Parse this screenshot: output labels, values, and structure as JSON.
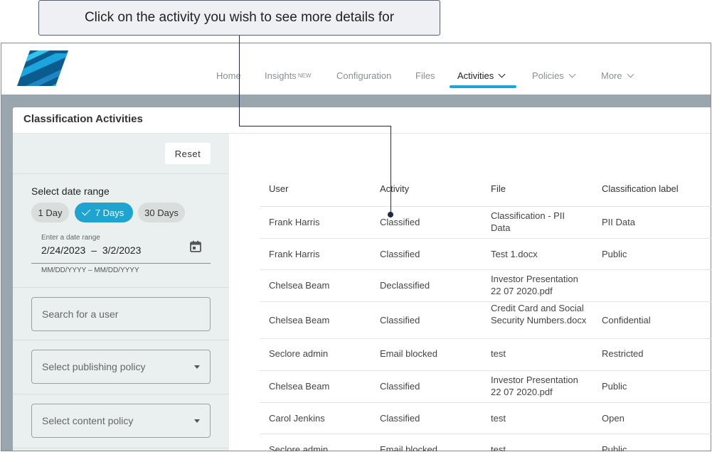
{
  "callout": {
    "text": "Click on the activity you wish to see more details for"
  },
  "nav": {
    "items": [
      {
        "label": "Home"
      },
      {
        "label": "Insights",
        "badge": "NEW"
      },
      {
        "label": "Configuration"
      },
      {
        "label": "Files"
      },
      {
        "label": "Activities",
        "active": true
      },
      {
        "label": "Policies"
      },
      {
        "label": "More"
      }
    ]
  },
  "colors": {
    "accent": "#1ea5d6",
    "band": "#9aa6ae",
    "panel": "#e9f0ef"
  },
  "page": {
    "title": "Classification Activities"
  },
  "filters": {
    "reset_label": "Reset",
    "date_range_label": "Select date range",
    "chips": [
      {
        "label": "1 Day",
        "selected": false
      },
      {
        "label": "7 Days",
        "selected": true
      },
      {
        "label": "30 Days",
        "selected": false
      }
    ],
    "date_field_label": "Enter a date range",
    "date_start": "2/24/2023",
    "date_end": "3/2/2023",
    "date_hint": "MM/DD/YYYY – MM/DD/YYYY",
    "user_search_placeholder": "Search for a user",
    "publishing_policy_placeholder": "Select publishing policy",
    "content_policy_placeholder": "Select content policy"
  },
  "table": {
    "columns": [
      "User",
      "Activity",
      "File",
      "Classification label"
    ],
    "rows": [
      {
        "user": "Frank Harris",
        "activity": "Classified",
        "file": "Classification - PII Data",
        "label": "PII Data"
      },
      {
        "user": "Frank Harris",
        "activity": "Classified",
        "file": "Test 1.docx",
        "label": "Public"
      },
      {
        "user": "Chelsea Beam",
        "activity": "Declassified",
        "file": "Investor Presentation 22 07 2020.pdf",
        "label": ""
      },
      {
        "user": "Chelsea Beam",
        "activity": "Classified",
        "file": "Credit Card and Social Security Numbers.docx",
        "label": "Confidential"
      },
      {
        "user": "Seclore admin",
        "activity": "Email blocked",
        "file": "test",
        "label": "Restricted"
      },
      {
        "user": "Chelsea Beam",
        "activity": "Classified",
        "file": "Investor Presentation 22 07 2020.pdf",
        "label": "Public"
      },
      {
        "user": "Carol Jenkins",
        "activity": "Classified",
        "file": "test",
        "label": "Open"
      },
      {
        "user": "Seclore admin",
        "activity": "Email blocked",
        "file": "test",
        "label": "Public"
      }
    ]
  }
}
